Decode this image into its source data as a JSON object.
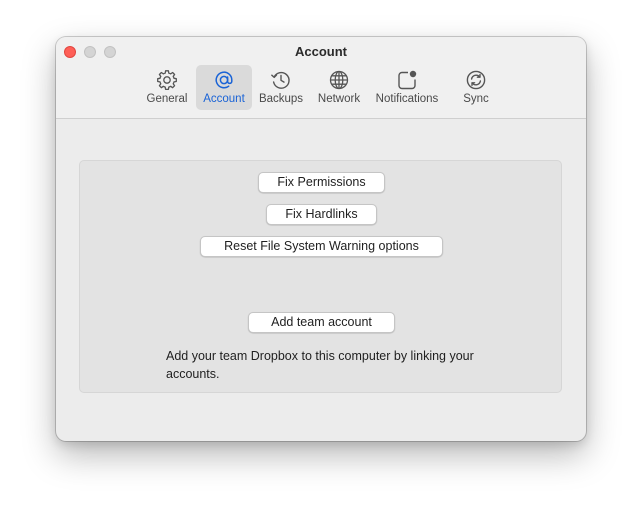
{
  "window": {
    "title": "Account"
  },
  "toolbar": {
    "tabs": [
      {
        "label": "General",
        "icon": "gear-icon"
      },
      {
        "label": "Account",
        "icon": "at-sign-icon",
        "selected": true
      },
      {
        "label": "Backups",
        "icon": "history-clock-icon"
      },
      {
        "label": "Network",
        "icon": "globe-icon"
      },
      {
        "label": "Notifications",
        "icon": "notification-badge-icon"
      },
      {
        "label": "Sync",
        "icon": "sync-icon"
      }
    ]
  },
  "account": {
    "fix_permissions_label": "Fix Permissions",
    "fix_hardlinks_label": "Fix Hardlinks",
    "reset_warnings_label": "Reset File System Warning options",
    "add_team_label": "Add team account",
    "team_description": "Add your team Dropbox to this computer by linking your accounts."
  },
  "colors": {
    "accent": "#1a63d6",
    "close_button": "#fe5f57",
    "window_background": "#ececec",
    "panel_background": "#e3e3e3"
  }
}
